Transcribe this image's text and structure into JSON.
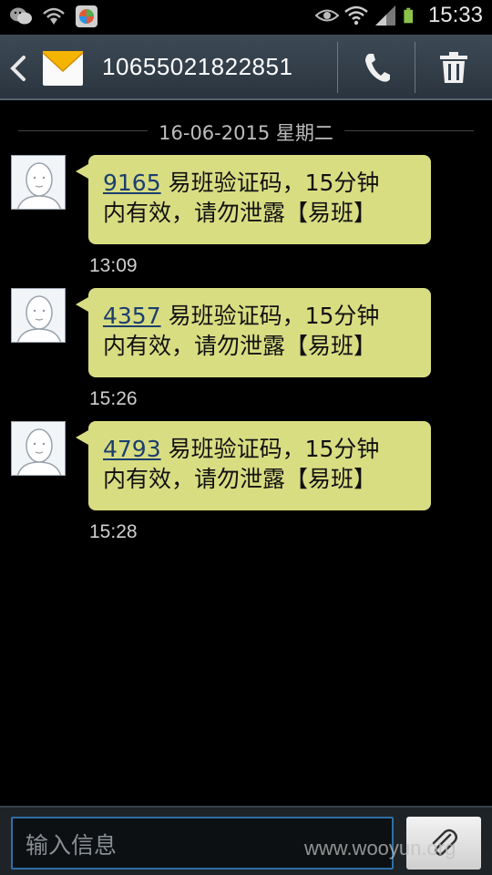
{
  "status_bar": {
    "time": "15:33",
    "icons": [
      "wechat-icon",
      "wifi-hotspot-icon",
      "app-icon",
      "eye-icon",
      "wifi-icon",
      "signal-icon",
      "battery-icon"
    ]
  },
  "action_bar": {
    "title": "10655021822851",
    "icons": [
      "back-icon",
      "envelope-icon",
      "phone-icon",
      "trash-icon"
    ]
  },
  "date_divider": "16-06-2015 星期二",
  "messages": [
    {
      "code": "9165",
      "text_line1": " 易班验证码，15分钟",
      "text_line2": "内有效，请勿泄露【易班】",
      "time": "13:09"
    },
    {
      "code": "4357",
      "text_line1": " 易班验证码，15分钟",
      "text_line2": "内有效，请勿泄露【易班】",
      "time": "15:26"
    },
    {
      "code": "4793",
      "text_line1": " 易班验证码，15分钟",
      "text_line2": "内有效，请勿泄露【易班】",
      "time": "15:28"
    }
  ],
  "compose": {
    "placeholder": "输入信息",
    "watermark": "www.wooyun.org"
  },
  "colors": {
    "bubble": "#d9dd82",
    "action_bar": "#34404b",
    "input_border": "#2e6fa8",
    "battery": "#8bc34a"
  }
}
